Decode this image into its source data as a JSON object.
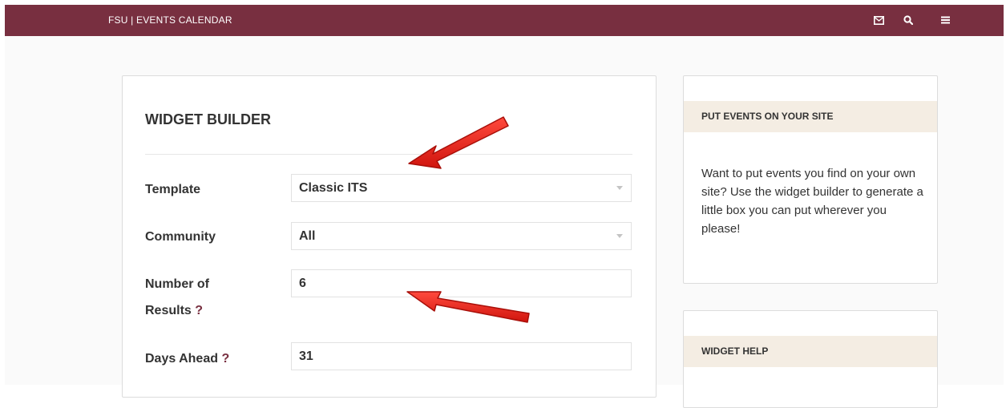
{
  "header": {
    "brand": "FSU | EVENTS CALENDAR",
    "icons": [
      "mail-icon",
      "search-icon",
      "menu-icon"
    ],
    "background": "#782f40"
  },
  "widget_builder": {
    "title": "WIDGET BUILDER",
    "fields": {
      "template": {
        "label": "Template",
        "value": "Classic ITS"
      },
      "community": {
        "label": "Community",
        "value": "All"
      },
      "number_of_results": {
        "label_line1": "Number of",
        "label_line2": "Results",
        "help": "?",
        "value": "6"
      },
      "days_ahead": {
        "label": "Days Ahead",
        "help": "?",
        "value": "31"
      }
    }
  },
  "sidebar": {
    "put_events": {
      "heading": "PUT EVENTS ON YOUR SITE",
      "text": "Want to put events you find on your own site? Use the widget builder to generate a little box you can put wherever you please!"
    },
    "widget_help": {
      "heading": "WIDGET HELP"
    }
  },
  "colors": {
    "accent": "#782f40",
    "sidebar_heading_bg": "#f4ede3",
    "arrow": "#e8231b"
  }
}
